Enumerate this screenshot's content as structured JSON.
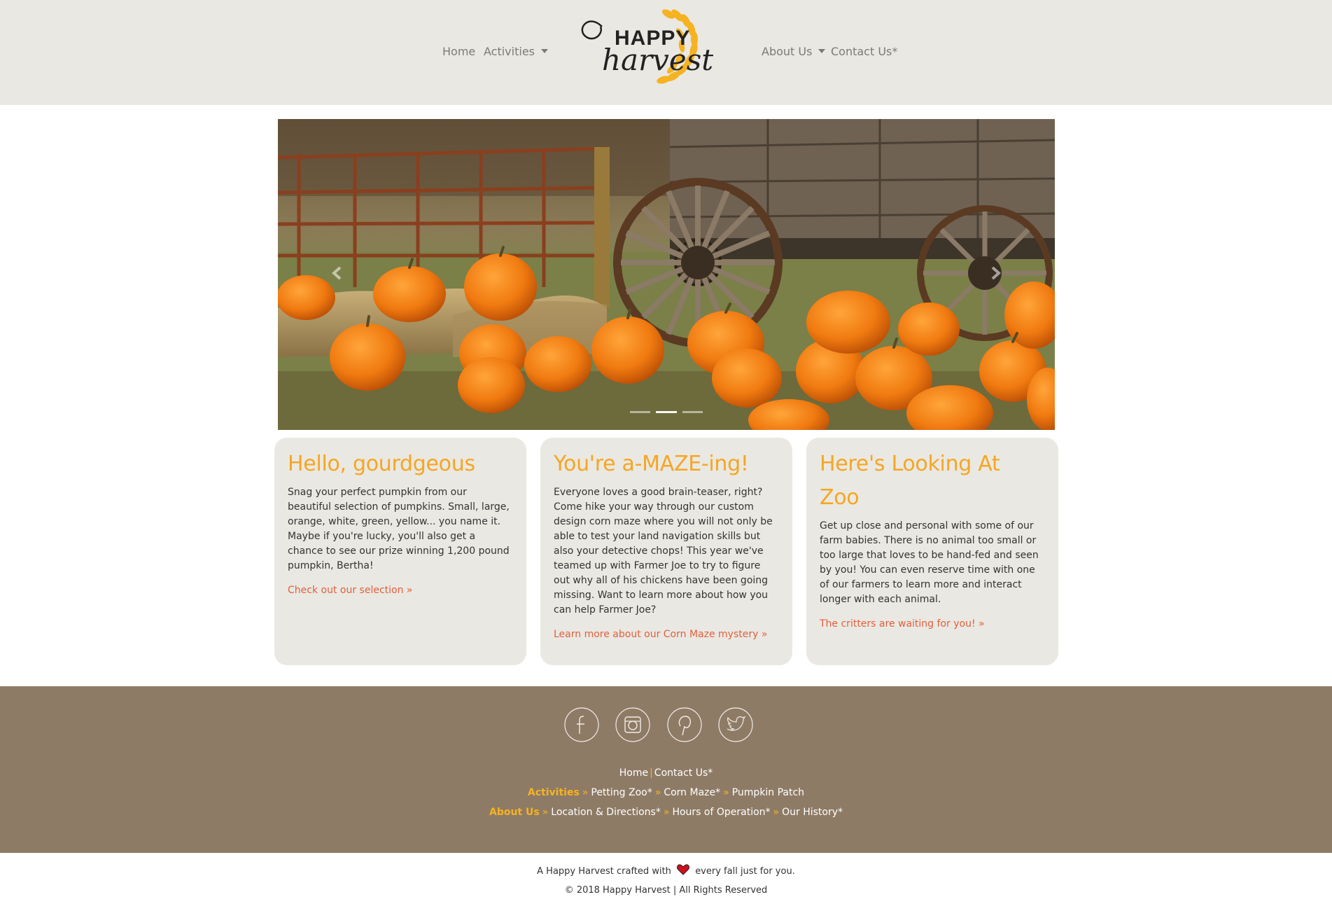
{
  "brand": {
    "name": "Happy Harvest",
    "logo_line1": "HAPPY",
    "logo_line2": "harvest"
  },
  "nav": {
    "home": "Home",
    "activities": "Activities",
    "about": "About Us",
    "contact": "Contact Us*"
  },
  "carousel": {
    "prev_icon": "chevron-left-icon",
    "next_icon": "chevron-right-icon",
    "slide_count": 3,
    "active_slide": 2
  },
  "cards": [
    {
      "title": "Hello, gourdgeous",
      "body": "Snag your perfect pumpkin from our beautiful selection of pumpkins. Small, large, orange, white, green, yellow... you name it. Maybe if you're lucky, you'll also get a chance to see our prize winning 1,200 pound pumpkin, Bertha!",
      "link": "Check out our selection »"
    },
    {
      "title": "You're a-MAZE-ing!",
      "body": "Everyone loves a good brain-teaser, right? Come hike your way through our custom design corn maze where you will not only be able to test your land navigation skills but also your detective chops! This year we've teamed up with Farmer Joe to try to figure out why all of his chickens have been going missing. Want to learn more about how you can help Farmer Joe?",
      "link": "Learn more about our Corn Maze mystery »"
    },
    {
      "title": "Here's Looking At Zoo",
      "body": "Get up close and personal with some of our farm babies. There is no animal too small or too large that loves to be hand-fed and seen by you! You can even reserve time with one of our farmers to learn more and interact longer with each animal.",
      "link": "The critters are waiting for you! »"
    }
  ],
  "footer": {
    "social": [
      "facebook-icon",
      "instagram-icon",
      "pinterest-icon",
      "twitter-icon"
    ],
    "row1": {
      "home": "Home",
      "sep": "|",
      "contact": "Contact Us*"
    },
    "row2": {
      "head": "Activities",
      "raq": "»",
      "items": [
        "Petting Zoo*",
        "Corn Maze*",
        "Pumpkin Patch"
      ]
    },
    "row3": {
      "head": "About Us",
      "raq": "»",
      "items": [
        "Location & Directions*",
        "Hours of Operation*",
        "Our History*"
      ]
    }
  },
  "credits": {
    "crafted_before": "A Happy Harvest crafted with",
    "crafted_after": "every fall just for you.",
    "heart_icon": "heart-icon",
    "copyright": "© 2018 Happy Harvest | All Rights Reserved"
  },
  "colors": {
    "accent": "#f5a623",
    "link": "#e0603e",
    "header_bg": "#eae8e2",
    "footer_bg": "#8e7b66"
  }
}
